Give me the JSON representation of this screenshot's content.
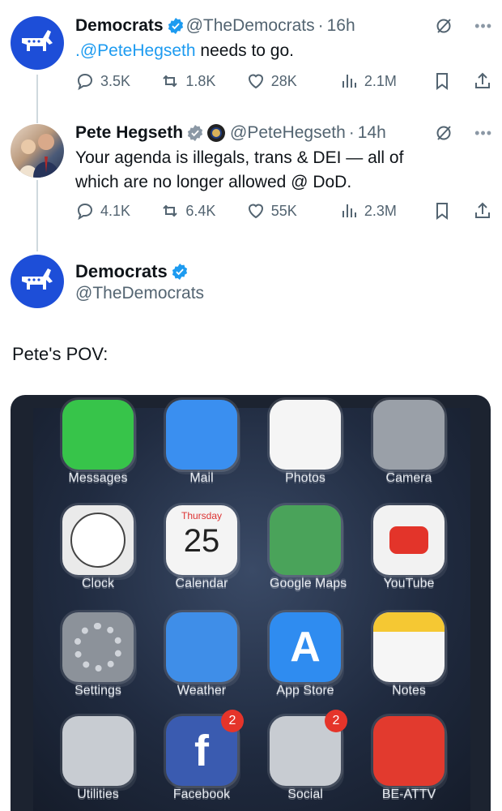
{
  "tweet1": {
    "name": "Democrats",
    "handle": "@TheDemocrats",
    "time": "16h",
    "text_mention": ".@PeteHegseth",
    "text_rest": " needs to go.",
    "stats": {
      "replies": "3.5K",
      "retweets": "1.8K",
      "likes": "28K",
      "views": "2.1M"
    }
  },
  "tweet2": {
    "name": "Pete Hegseth",
    "handle": "@PeteHegseth",
    "time": "14h",
    "text_line1": "Your agenda is illegals, trans & DEI — all of",
    "text_line2": "which are no longer allowed @ DoD.",
    "stats": {
      "replies": "4.1K",
      "retweets": "6.4K",
      "likes": "55K",
      "views": "2.3M"
    }
  },
  "main_tweet": {
    "name": "Democrats",
    "handle": "@TheDemocrats",
    "text": "Pete's POV:"
  },
  "separator": "·",
  "more": "•••",
  "phone_apps": [
    {
      "label": "Messages",
      "color": "#37c44a"
    },
    {
      "label": "Mail",
      "color": "#3a8ff0"
    },
    {
      "label": "Photos",
      "color": "#f5f5f5"
    },
    {
      "label": "Camera",
      "color": "#9aa0a8"
    },
    {
      "label": "Clock",
      "color": "#eaeaea"
    },
    {
      "label": "Calendar",
      "color": "#f4f4f4",
      "day": "Thursday",
      "date": "25"
    },
    {
      "label": "Google Maps",
      "color": "#4aa35a"
    },
    {
      "label": "YouTube",
      "color": "#f2f2f2"
    },
    {
      "label": "Settings",
      "color": "#8c929a"
    },
    {
      "label": "Weather",
      "color": "#3f8ee8"
    },
    {
      "label": "App Store",
      "color": "#2f8cf0"
    },
    {
      "label": "Notes",
      "color": "#f6f6f6"
    },
    {
      "label": "Utilities",
      "color": "#c8ccd2"
    },
    {
      "label": "Facebook",
      "color": "#3a5bb0",
      "badge": "2"
    },
    {
      "label": "Social",
      "color": "#c8ccd2",
      "badge": "2"
    },
    {
      "label": "BE-ATTV",
      "color": "#e23a2e"
    }
  ],
  "colors": {
    "accent": "#1d9bf0",
    "dem_blue": "#1d4ed8",
    "muted": "#536471"
  }
}
